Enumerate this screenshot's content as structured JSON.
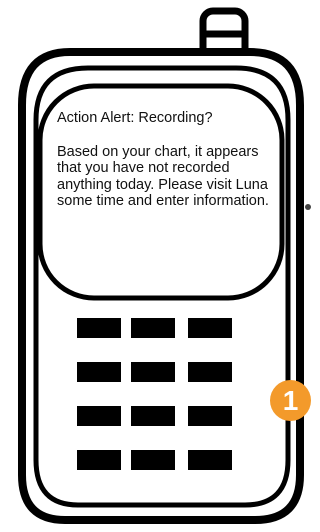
{
  "alert": {
    "title": "Action Alert: Recording?",
    "message": "Based on your chart, it appears that you have not recorded anything today. Please visit Luna some time and enter information."
  },
  "badge": {
    "label": "1",
    "color": "#f39a2b"
  },
  "keypad": {
    "rows": 4,
    "columns": 3
  },
  "icons": {
    "device": "mobile-phone-icon",
    "antenna": "antenna-icon",
    "side_dot": "dot-icon"
  }
}
